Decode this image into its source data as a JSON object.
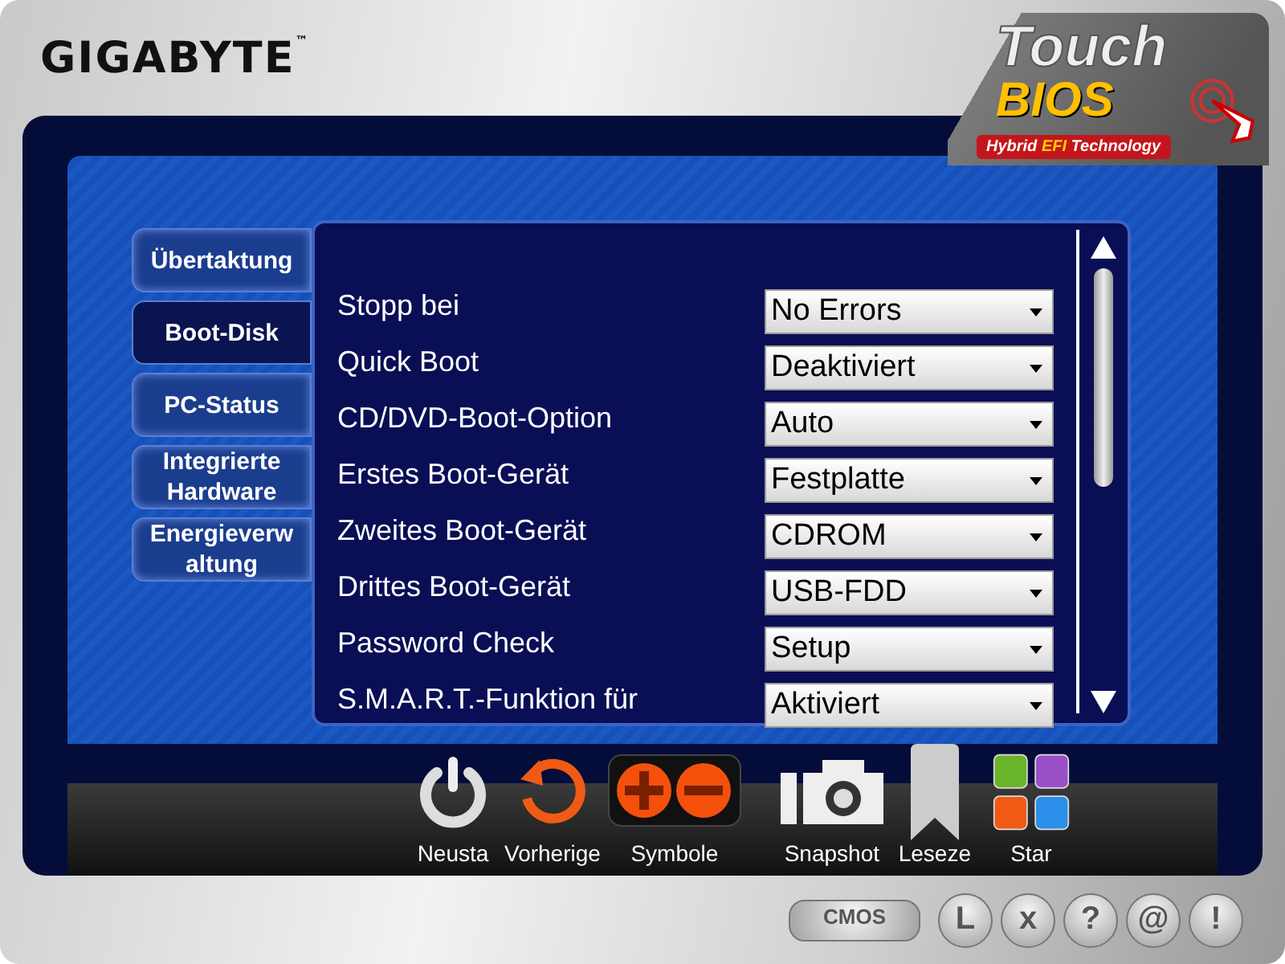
{
  "brand": "GIGABYTE",
  "brand_mark": "™",
  "logo": {
    "line1": "Touch",
    "line2": "BIOS",
    "tagline_start": "Hybrid",
    "tagline_mid": "EFI",
    "tagline_end": "Technology"
  },
  "tabs": [
    {
      "label": "Übertaktung",
      "selected": false
    },
    {
      "label": "Boot-Disk",
      "selected": true
    },
    {
      "label": "PC-Status",
      "selected": false
    },
    {
      "label": "Integrierte Hardware",
      "selected": false
    },
    {
      "label": "Energieverw altung",
      "selected": false
    }
  ],
  "settings": [
    {
      "label": "Stopp bei",
      "value": "No Errors"
    },
    {
      "label": "Quick Boot",
      "value": "Deaktiviert"
    },
    {
      "label": "CD/DVD-Boot-Option",
      "value": "Auto"
    },
    {
      "label": "Erstes Boot-Gerät",
      "value": "Festplatte"
    },
    {
      "label": "Zweites Boot-Gerät",
      "value": "CDROM"
    },
    {
      "label": "Drittes Boot-Gerät",
      "value": "USB-FDD"
    },
    {
      "label": "Password Check",
      "value": "Setup"
    },
    {
      "label": "S.M.A.R.T.-Funktion für",
      "value": "Aktiviert"
    }
  ],
  "dock": [
    {
      "label": "Neusta",
      "kind": "power"
    },
    {
      "label": "Vorherige",
      "kind": "undo"
    },
    {
      "label": "Symbole",
      "kind": "zoom"
    },
    {
      "label": "Snapshot",
      "kind": "camera"
    },
    {
      "label": "Leseze",
      "kind": "bookmark"
    },
    {
      "label": "Star",
      "kind": "tiles"
    }
  ],
  "bottom_buttons": [
    {
      "label": "CMOS",
      "kind": "pill"
    },
    {
      "label": "L",
      "kind": "round"
    },
    {
      "label": "x",
      "kind": "round"
    },
    {
      "label": "?",
      "kind": "round"
    },
    {
      "label": "@",
      "kind": "round"
    },
    {
      "label": "!",
      "kind": "round"
    }
  ]
}
